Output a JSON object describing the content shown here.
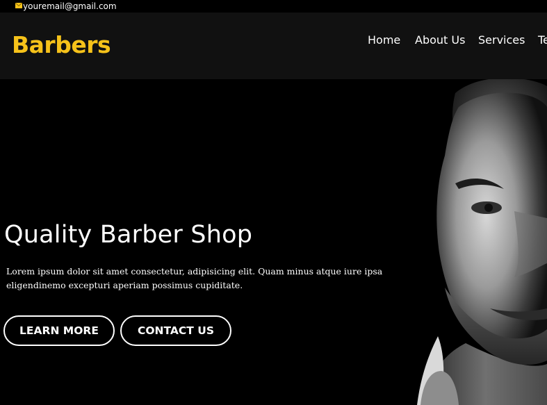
{
  "topbar": {
    "email": "youremail@gmail.com",
    "icon": "envelope-icon",
    "icon_color": "#f6c21a"
  },
  "brand": {
    "name": "Barbers",
    "color": "#f6c21a"
  },
  "nav": {
    "items": [
      "Home",
      "About Us",
      "Services",
      "Te"
    ]
  },
  "hero": {
    "title": "Quality Barber Shop",
    "text": "Lorem ipsum dolor sit amet consectetur, adipisicing elit. Quam minus atque iure ipsa eligendinemo excepturi aperiam possimus cupiditate.",
    "buttons": {
      "learn_more": "LEARN MORE",
      "contact_us": "CONTACT US"
    },
    "image": "black-and-white-portrait-of-man"
  }
}
